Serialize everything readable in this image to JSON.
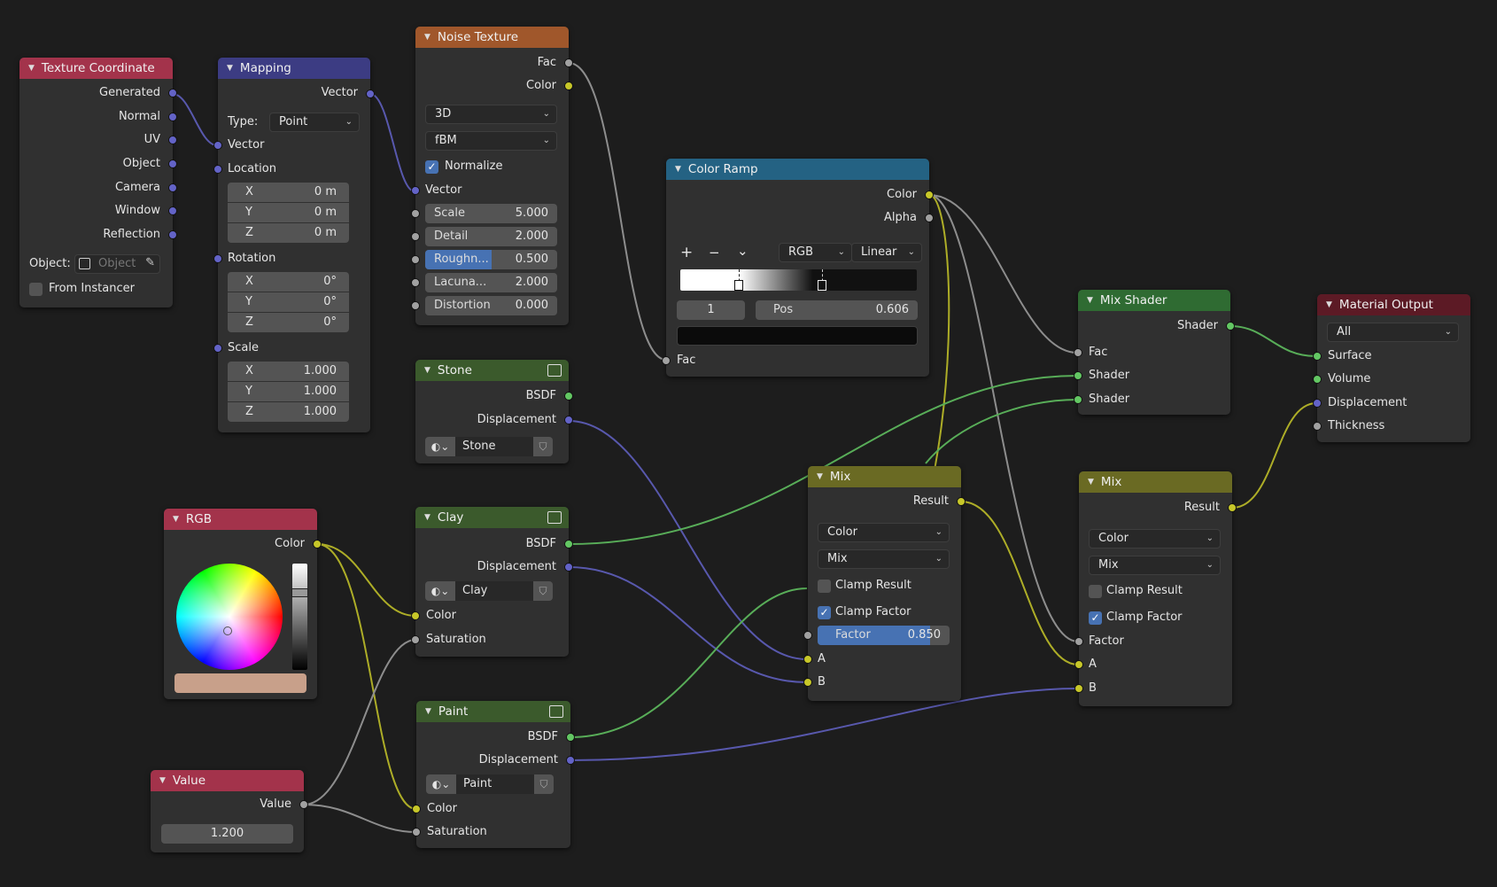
{
  "colors": {
    "vector": "#6363c7",
    "color": "#c7c729",
    "float": "#a1a1a1",
    "shader": "#63c763"
  },
  "texture_coordinate": {
    "title": "Texture Coordinate",
    "outputs": [
      "Generated",
      "Normal",
      "UV",
      "Object",
      "Camera",
      "Window",
      "Reflection"
    ],
    "object_label": "Object:",
    "object_placeholder": "Object",
    "from_instancer": "From Instancer"
  },
  "mapping": {
    "title": "Mapping",
    "output": "Vector",
    "type_label": "Type:",
    "type_value": "Point",
    "vector": "Vector",
    "location": {
      "label": "Location",
      "x": "0 m",
      "y": "0 m",
      "z": "0 m"
    },
    "rotation": {
      "label": "Rotation",
      "x": "0°",
      "y": "0°",
      "z": "0°"
    },
    "scale": {
      "label": "Scale",
      "x": "1.000",
      "y": "1.000",
      "z": "1.000"
    },
    "axes": [
      "X",
      "Y",
      "Z"
    ]
  },
  "noise": {
    "title": "Noise Texture",
    "out_fac": "Fac",
    "out_color": "Color",
    "dimensions": "3D",
    "type": "fBM",
    "normalize": "Normalize",
    "vector": "Vector",
    "fields": [
      {
        "label": "Scale",
        "value": "5.000"
      },
      {
        "label": "Detail",
        "value": "2.000"
      },
      {
        "label": "Roughn...",
        "value": "0.500",
        "fill": 0.5
      },
      {
        "label": "Lacuna...",
        "value": "2.000"
      },
      {
        "label": "Distortion",
        "value": "0.000"
      }
    ]
  },
  "color_ramp": {
    "title": "Color Ramp",
    "out_color": "Color",
    "out_alpha": "Alpha",
    "mode": "RGB",
    "interpolation": "Linear",
    "index": "1",
    "pos_label": "Pos",
    "pos_value": "0.606",
    "input_fac": "Fac",
    "add": "+",
    "remove": "−",
    "menu": "⌄"
  },
  "groups": [
    {
      "title": "Stone",
      "out1": "BSDF",
      "out2": "Displacement",
      "material": "Stone"
    },
    {
      "title": "Clay",
      "out1": "BSDF",
      "out2": "Displacement",
      "material": "Clay",
      "in1": "Color",
      "in2": "Saturation"
    },
    {
      "title": "Paint",
      "out1": "BSDF",
      "out2": "Displacement",
      "material": "Paint",
      "in1": "Color",
      "in2": "Saturation"
    }
  ],
  "rgb": {
    "title": "RGB",
    "output": "Color",
    "swatch": "#c8a08a"
  },
  "value": {
    "title": "Value",
    "output": "Value",
    "value": "1.200"
  },
  "mix1": {
    "title": "Mix",
    "output": "Result",
    "data_type": "Color",
    "blend": "Mix",
    "clamp_result": "Clamp Result",
    "clamp_factor": "Clamp Factor",
    "factor_label": "Factor",
    "factor_value": "0.850",
    "factor_fill": 0.85,
    "in_a": "A",
    "in_b": "B"
  },
  "mix_shader": {
    "title": "Mix Shader",
    "output": "Shader",
    "in_fac": "Fac",
    "in_shader1": "Shader",
    "in_shader2": "Shader"
  },
  "mix2": {
    "title": "Mix",
    "output": "Result",
    "data_type": "Color",
    "blend": "Mix",
    "clamp_result": "Clamp Result",
    "clamp_factor": "Clamp Factor",
    "in_factor": "Factor",
    "in_a": "A",
    "in_b": "B"
  },
  "material_output": {
    "title": "Material Output",
    "target": "All",
    "inputs": [
      "Surface",
      "Volume",
      "Displacement",
      "Thickness"
    ]
  }
}
